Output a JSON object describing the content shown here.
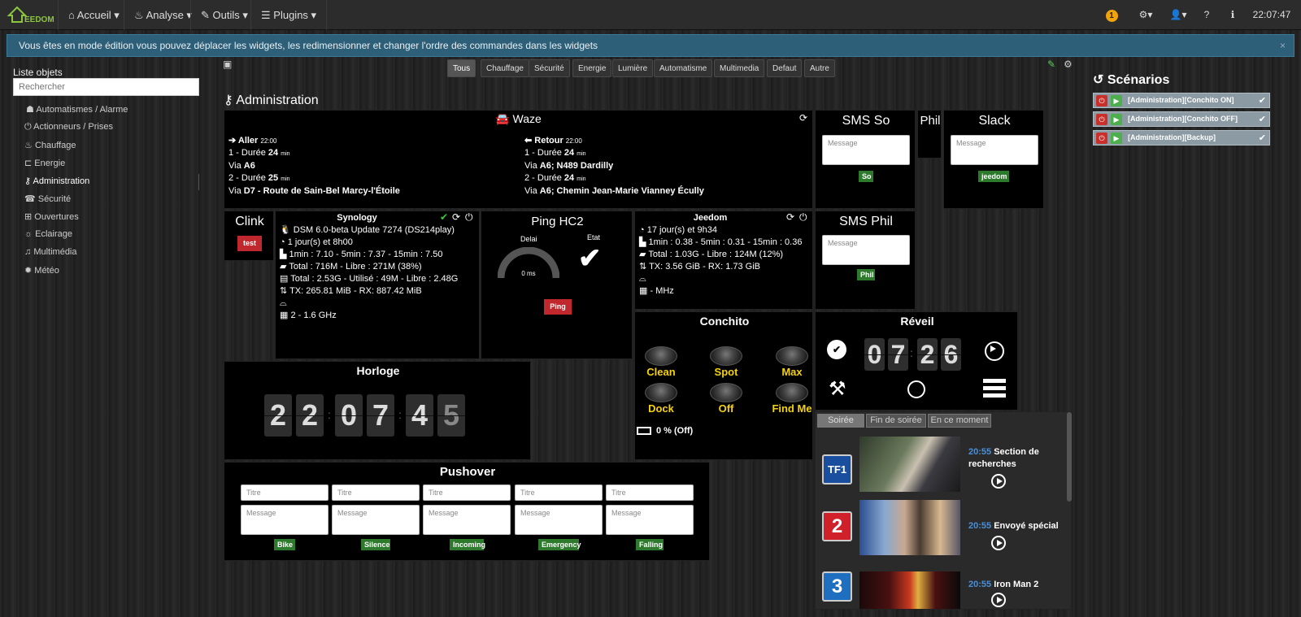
{
  "nav": {
    "accueil": "Accueil",
    "analyse": "Analyse",
    "outils": "Outils",
    "plugins": "Plugins",
    "badge": "1",
    "time": "22:07:47",
    "logo": "EEDOM"
  },
  "alert": {
    "text": "Vous êtes en mode édition vous pouvez déplacer les widgets, les redimensionner et changer l'ordre des commandes dans les widgets",
    "close": "×"
  },
  "sidebar": {
    "title": "Liste objets",
    "search_placeholder": "Rechercher",
    "items": [
      {
        "label": "Automatismes / Alarme"
      },
      {
        "label": "Actionneurs / Prises"
      },
      {
        "label": "Chauffage"
      },
      {
        "label": "Energie"
      },
      {
        "label": "Administration"
      },
      {
        "label": "Sécurité"
      },
      {
        "label": "Ouvertures"
      },
      {
        "label": "Eclairage"
      },
      {
        "label": "Multimédia"
      },
      {
        "label": "Météo"
      }
    ]
  },
  "filters": [
    "Tous",
    "Chauffage",
    "Sécurité",
    "Energie",
    "Lumière",
    "Automatisme",
    "Multimedia",
    "Defaut",
    "Autre"
  ],
  "page_title": "Administration",
  "waze": {
    "title": "Waze",
    "aller": "Aller",
    "retour": "Retour",
    "time": "22:00",
    "a1": "1 - Durée ",
    "a1v": "24",
    "min": "min",
    "a2": "Via ",
    "a2v": "A6",
    "a3": "2 - Durée ",
    "a3v": "25",
    "a4": "Via ",
    "a4v": "D7 - Route de Sain-Bel Marcy-l'Étoile",
    "r1": "1 - Durée ",
    "r1v": "24",
    "r2": "Via ",
    "r2v": "A6; N489 Dardilly",
    "r3": "2 - Durée ",
    "r3v": "24",
    "r4": "Via ",
    "r4v": "A6; Chemin Jean-Marie Vianney Écully"
  },
  "sms_so": {
    "title": "SMS So",
    "placeholder": "Message",
    "button": "So"
  },
  "phil": {
    "title": "Phil"
  },
  "slack": {
    "title": "Slack",
    "placeholder": "Message",
    "button": "jeedom"
  },
  "clink": {
    "title": "Clink",
    "button": "test"
  },
  "synology": {
    "title": "Synology",
    "lines": [
      "DSM 6.0-beta Update 7274 (DS214play)",
      "1 jour(s) et 8h00",
      "1min : 7.10 - 5min : 7.37 - 15min : 7.50",
      "Total : 716M - Libre : 271M (38%)",
      "Total : 2.53G - Utilisé : 49M - Libre : 2.48G",
      "TX: 265.81 MiB - RX: 887.42 MiB",
      "",
      "2 - 1.6 GHz"
    ]
  },
  "ping": {
    "title": "Ping HC2",
    "delai": "Delai",
    "etat": "Etat",
    "gauge": "0 ms",
    "gauge_value": 0,
    "button": "Ping"
  },
  "jeedom": {
    "title": "Jeedom",
    "lines": [
      "17 jour(s) et 9h34",
      "1min : 0.38 - 5min : 0.31 - 15min : 0.36",
      "Total : 1.03G - Libre : 124M (12%)",
      "TX: 3.56 GiB - RX: 1.73 GiB",
      "",
      "- MHz"
    ]
  },
  "sms_phil": {
    "title": "SMS Phil",
    "placeholder": "Message",
    "button": "Phil"
  },
  "conchito": {
    "title": "Conchito",
    "buttons": [
      "Clean",
      "Spot",
      "Max",
      "Dock",
      "Off",
      "Find Me"
    ],
    "battery": "0 % (Off)"
  },
  "reveil": {
    "title": "Réveil",
    "digits": [
      "0",
      "7",
      "2",
      "6"
    ]
  },
  "horloge": {
    "title": "Horloge",
    "digits": [
      "2",
      "2",
      "0",
      "7",
      "4",
      "5"
    ]
  },
  "pushover": {
    "title": "Pushover",
    "title_placeholder": "Titre",
    "message_placeholder": "Message",
    "buttons": [
      "Bike",
      "Silence",
      "Incoming",
      "Emergency",
      "Falling"
    ]
  },
  "tv": {
    "tabs": [
      "Soirée",
      "Fin de soirée",
      "En ce moment"
    ],
    "programs": [
      {
        "channel": "TF1",
        "time": "20:55",
        "title": "Section de recherches",
        "color": "#1a4fa0"
      },
      {
        "channel": "2",
        "time": "20:55",
        "title": "Envoyé spécial",
        "color": "#d0202a"
      },
      {
        "channel": "3",
        "time": "20:55",
        "title": "Iron Man 2",
        "color": "#1f6fc0"
      }
    ]
  },
  "scenarios": {
    "title": "Scénarios",
    "items": [
      "[Administration][Conchito ON]",
      "[Administration][Conchito OFF]",
      "[Administration][Backup]"
    ]
  },
  "colors": {
    "accent_green": "#2d7a2d",
    "accent_red": "#c0282d",
    "yellow": "#f5d20b",
    "alert_bg": "#2e5f78"
  }
}
